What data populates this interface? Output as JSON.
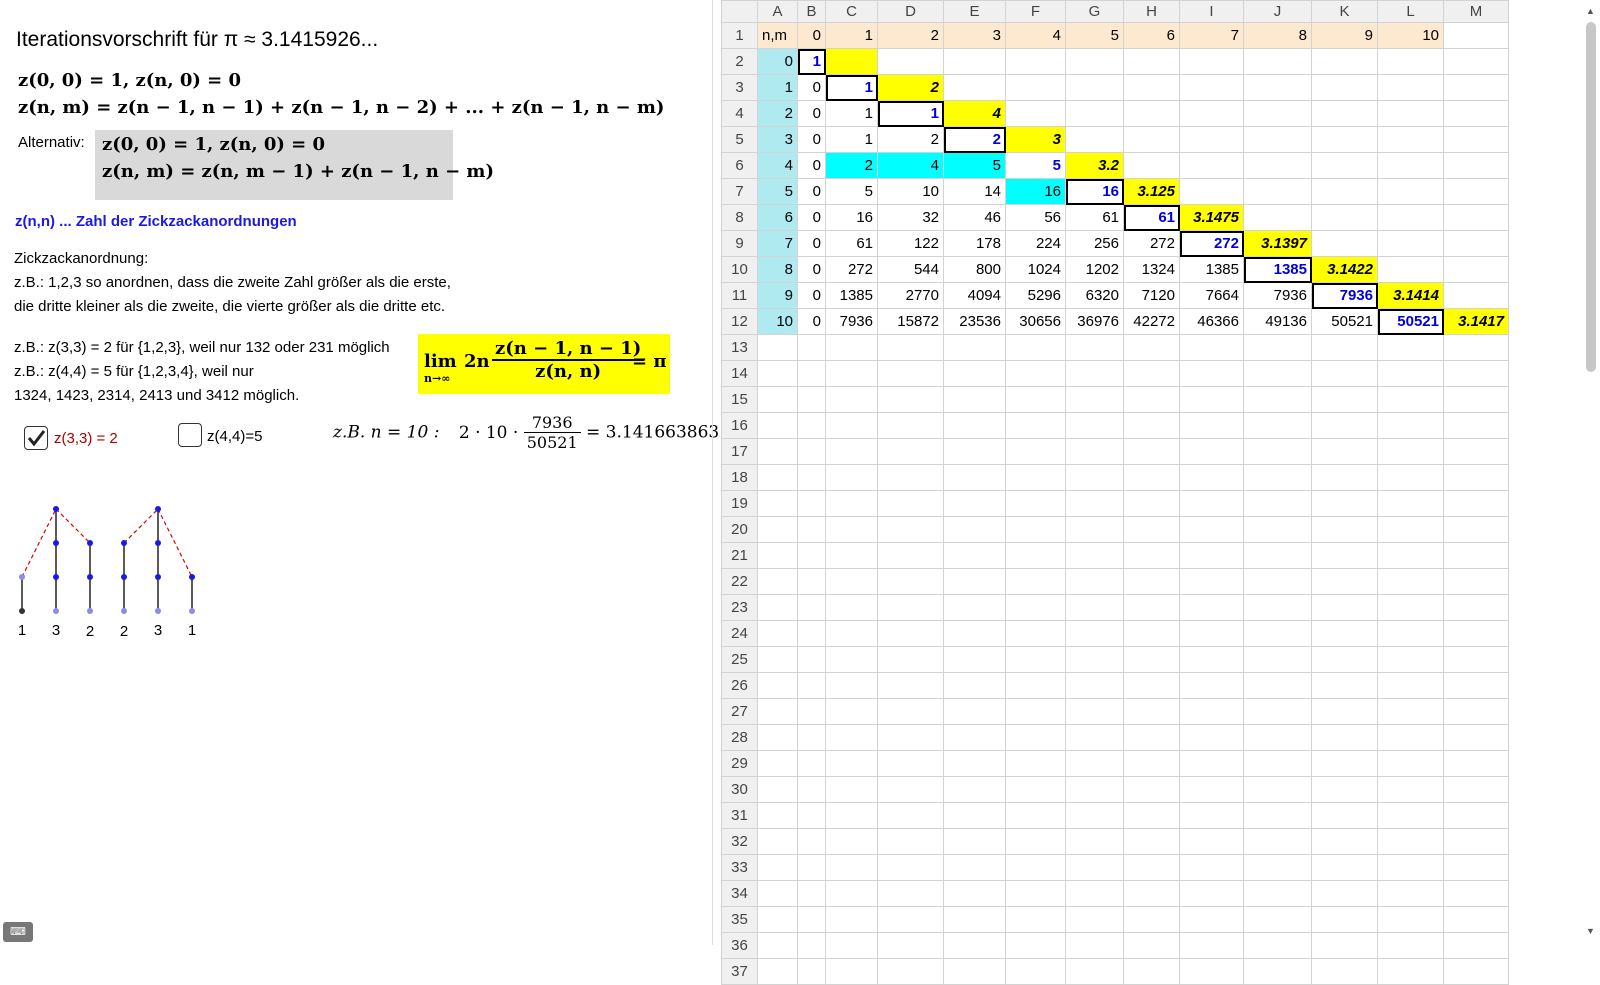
{
  "left": {
    "title": "Iterationsvorschrift für π ≈ 3.1415926...",
    "formula1": "z(0, 0) = 1, z(n, 0) = 0",
    "formula2": "z(n, m) = z(n − 1, n − 1) + z(n − 1, n − 2) + ... + z(n − 1, n − m)",
    "alt_label": "Alternativ:",
    "alt_formula1": "z(0, 0) = 1, z(n, 0) = 0",
    "alt_formula2": "z(n, m) = z(n, m − 1) + z(n − 1, n − m)",
    "definition": "z(n,n) ... Zahl der Zickzackanordnungen",
    "zz_title": "Zickzackanordnung:",
    "zz_line1": "z.B.: 1,2,3 so anordnen, dass die zweite Zahl größer als die erste,",
    "zz_line2": "die dritte kleiner als die zweite, die vierte größer als die dritte etc.",
    "ex_line1": "z.B.: z(3,3) = 2 für {1,2,3}, weil nur 132 oder 231 möglich",
    "ex_line2": "z.B.: z(4,4) = 5 für {1,2,3,4}, weil nur",
    "ex_line3": "1324, 1423, 2314, 2413 und 3412 möglich.",
    "lim_text": "lim",
    "lim_sub": "n→∞",
    "lim_factor": "2n",
    "lim_num": "z(n − 1, n − 1)",
    "lim_den": "z(n, n)",
    "lim_rhs": "= π",
    "checkbox1_label": "z(3,3) = 2",
    "checkbox1_checked": true,
    "checkbox2_label": "z(4,4)=5",
    "checkbox2_checked": false,
    "example_prefix": "z.B. n = 10 :",
    "example_factor": "2 · 10 ·",
    "example_num": "7936",
    "example_den": "50521",
    "example_result": "= 3.141663863",
    "diagram_labels": [
      "1",
      "3",
      "2",
      "2",
      "3",
      "1"
    ],
    "keyboard_icon": "keyboard-icon"
  },
  "sheet": {
    "columns": [
      "A",
      "B",
      "C",
      "D",
      "E",
      "F",
      "G",
      "H",
      "I",
      "J",
      "K",
      "L",
      "M"
    ],
    "header_row": [
      "n,m",
      "0",
      "1",
      "2",
      "3",
      "4",
      "5",
      "6",
      "7",
      "8",
      "9",
      "10",
      ""
    ],
    "rows": [
      [
        "0",
        "1",
        "",
        "",
        "",
        "",
        "",
        "",
        "",
        "",
        "",
        "",
        ""
      ],
      [
        "1",
        "0",
        "1",
        "2",
        "",
        "",
        "",
        "",
        "",
        "",
        "",
        "",
        ""
      ],
      [
        "2",
        "0",
        "1",
        "1",
        "4",
        "",
        "",
        "",
        "",
        "",
        "",
        "",
        ""
      ],
      [
        "3",
        "0",
        "1",
        "2",
        "2",
        "3",
        "",
        "",
        "",
        "",
        "",
        "",
        ""
      ],
      [
        "4",
        "0",
        "2",
        "4",
        "5",
        "5",
        "3.2",
        "",
        "",
        "",
        "",
        "",
        ""
      ],
      [
        "5",
        "0",
        "5",
        "10",
        "14",
        "16",
        "16",
        "3.125",
        "",
        "",
        "",
        "",
        ""
      ],
      [
        "6",
        "0",
        "16",
        "32",
        "46",
        "56",
        "61",
        "61",
        "3.1475",
        "",
        "",
        "",
        ""
      ],
      [
        "7",
        "0",
        "61",
        "122",
        "178",
        "224",
        "256",
        "272",
        "272",
        "3.1397",
        "",
        "",
        ""
      ],
      [
        "8",
        "0",
        "272",
        "544",
        "800",
        "1024",
        "1202",
        "1324",
        "1385",
        "1385",
        "3.1422",
        "",
        ""
      ],
      [
        "9",
        "0",
        "1385",
        "2770",
        "4094",
        "5296",
        "6320",
        "7120",
        "7664",
        "7936",
        "7936",
        "3.1414",
        ""
      ],
      [
        "10",
        "0",
        "7936",
        "15872",
        "23536",
        "30656",
        "36976",
        "42272",
        "46366",
        "49136",
        "50521",
        "50521",
        "3.1417"
      ]
    ],
    "total_rows": 37,
    "colors": {
      "header": "#fde9cf",
      "cyan_light": "#aeeaf0",
      "cyan": "#00ffff",
      "yellow": "#ffff00",
      "blue_text": "#0000dd"
    }
  }
}
